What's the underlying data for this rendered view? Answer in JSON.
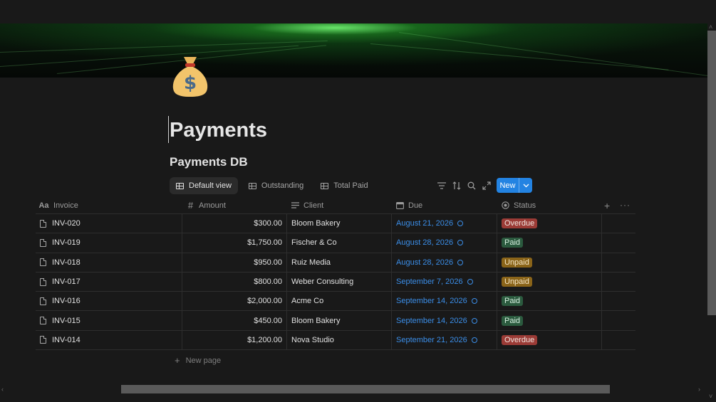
{
  "page": {
    "title": "Payments",
    "icon": "money-bag-icon"
  },
  "database": {
    "title": "Payments DB",
    "views": [
      {
        "label": "Default view",
        "active": true
      },
      {
        "label": "Outstanding",
        "active": false
      },
      {
        "label": "Total Paid",
        "active": false
      }
    ],
    "new_button_label": "New",
    "columns": [
      {
        "label": "Invoice",
        "icon": "text-aa-icon"
      },
      {
        "label": "Amount",
        "icon": "hash-icon"
      },
      {
        "label": "Client",
        "icon": "lines-icon"
      },
      {
        "label": "Due",
        "icon": "calendar-icon"
      },
      {
        "label": "Status",
        "icon": "status-icon"
      }
    ],
    "rows": [
      {
        "invoice": "INV-020",
        "amount": "$300.00",
        "client": "Bloom Bakery",
        "due": "August 21, 2026",
        "status": "Overdue"
      },
      {
        "invoice": "INV-019",
        "amount": "$1,750.00",
        "client": "Fischer & Co",
        "due": "August 28, 2026",
        "status": "Paid"
      },
      {
        "invoice": "INV-018",
        "amount": "$950.00",
        "client": "Ruiz Media",
        "due": "August 28, 2026",
        "status": "Unpaid"
      },
      {
        "invoice": "INV-017",
        "amount": "$800.00",
        "client": "Weber Consulting",
        "due": "September 7, 2026",
        "status": "Unpaid"
      },
      {
        "invoice": "INV-016",
        "amount": "$2,000.00",
        "client": "Acme Co",
        "due": "September 14, 2026",
        "status": "Paid"
      },
      {
        "invoice": "INV-015",
        "amount": "$450.00",
        "client": "Bloom Bakery",
        "due": "September 14, 2026",
        "status": "Paid"
      },
      {
        "invoice": "INV-014",
        "amount": "$1,200.00",
        "client": "Nova Studio",
        "due": "September 21, 2026",
        "status": "Overdue"
      }
    ],
    "new_page_label": "New page"
  },
  "colors": {
    "background": "#191919",
    "accent": "#2383e2",
    "date_link": "#3b8ee8",
    "status_overdue": "#9b3b36",
    "status_paid": "#2b5a3e",
    "status_unpaid": "#8a6419"
  }
}
